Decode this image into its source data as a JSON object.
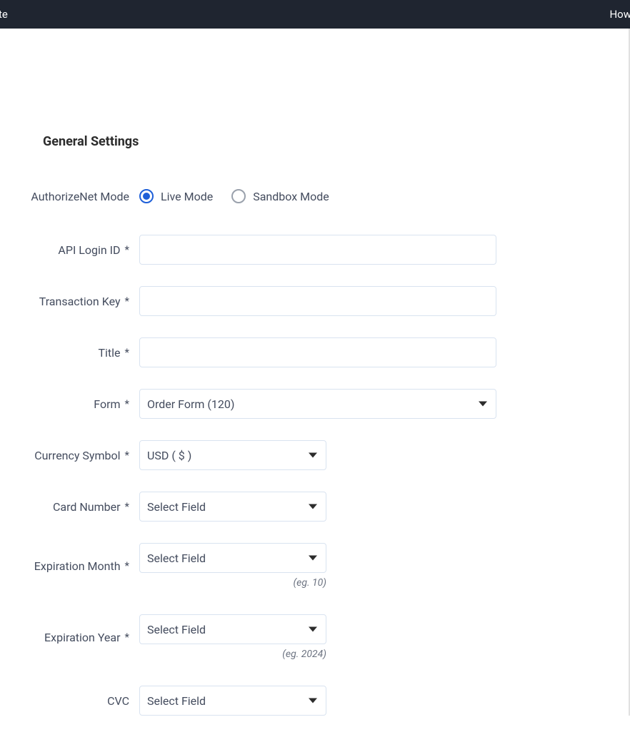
{
  "topbar": {
    "left_fragment": "te",
    "right_fragment": "How"
  },
  "section": {
    "title": "General Settings"
  },
  "fields": {
    "mode": {
      "label": "AuthorizeNet Mode",
      "options": {
        "live": "Live Mode",
        "sandbox": "Sandbox Mode"
      },
      "selected": "live"
    },
    "api_login_id": {
      "label": "API Login ID",
      "required": true,
      "value": ""
    },
    "transaction_key": {
      "label": "Transaction Key",
      "required": true,
      "value": ""
    },
    "title_field": {
      "label": "Title",
      "required": true,
      "value": ""
    },
    "form": {
      "label": "Form",
      "required": true,
      "value": "Order Form (120)"
    },
    "currency": {
      "label": "Currency Symbol",
      "required": true,
      "value": "USD ( $ )"
    },
    "card_number": {
      "label": "Card Number",
      "required": true,
      "value": "Select Field"
    },
    "exp_month": {
      "label": "Expiration Month",
      "required": true,
      "value": "Select Field",
      "helper": "(eg. 10)"
    },
    "exp_year": {
      "label": "Expiration Year",
      "required": true,
      "value": "Select Field",
      "helper": "(eg. 2024)"
    },
    "cvc": {
      "label": "CVC",
      "required": false,
      "value": "Select Field"
    }
  }
}
